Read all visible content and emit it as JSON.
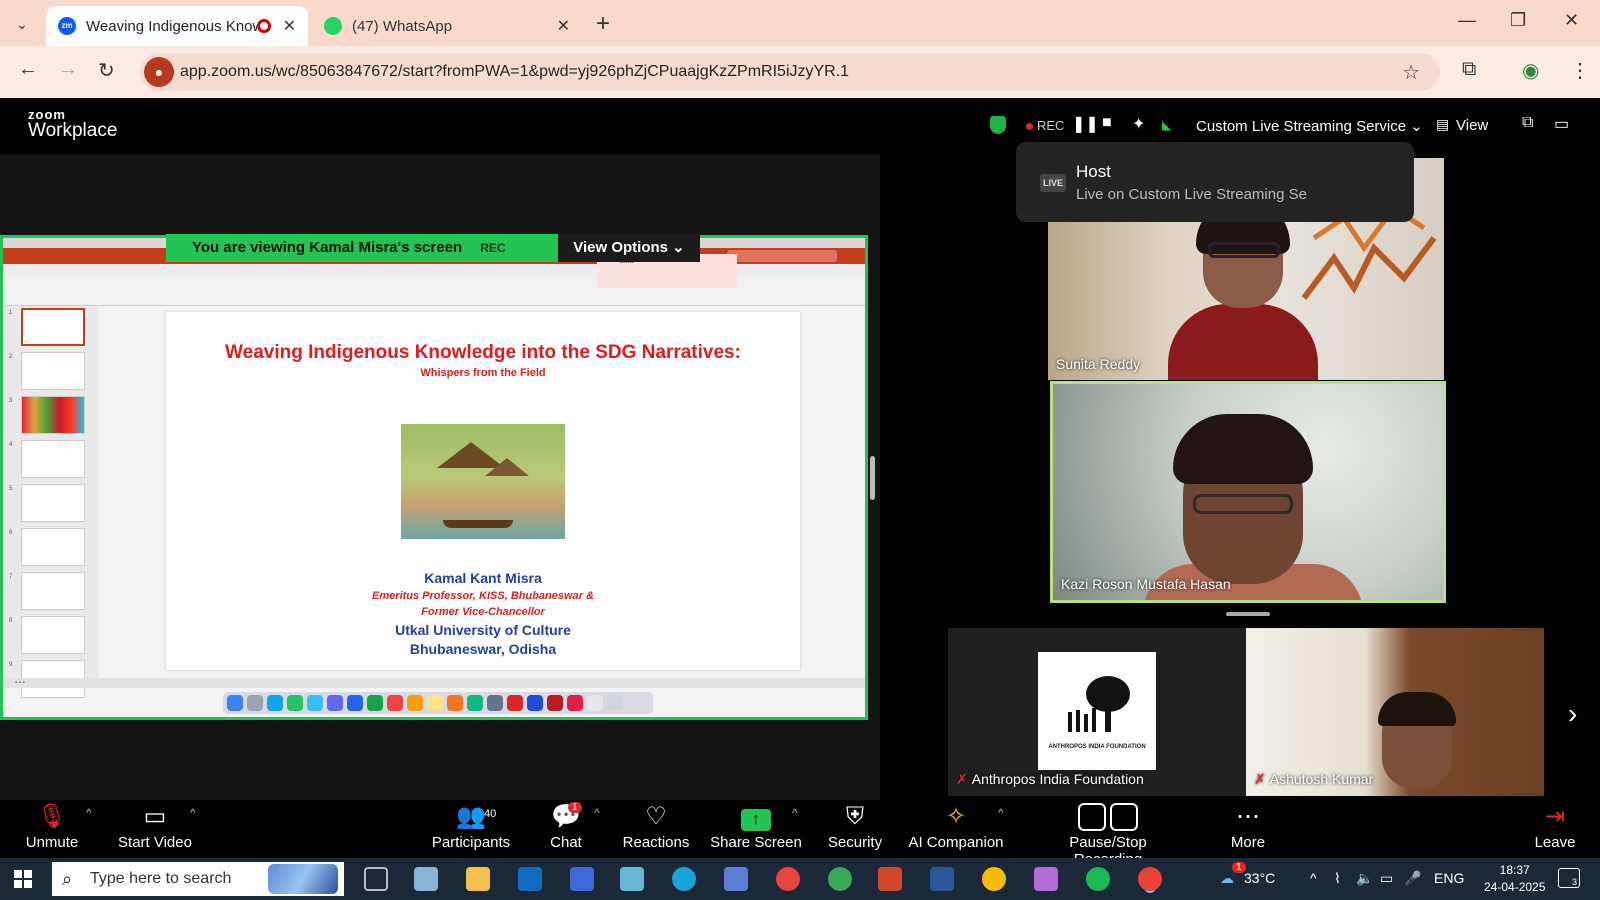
{
  "browser": {
    "tabs": [
      {
        "title": "Weaving Indigenous Knowle",
        "favicon": "zoom-icon",
        "active": true
      },
      {
        "title": "(47) WhatsApp",
        "favicon": "whatsapp-icon",
        "active": false
      }
    ],
    "url": "app.zoom.us/wc/85063847672/start?fromPWA=1&pwd=yj926phZjCPuaajgKzZPmRI5iJzyYR.1"
  },
  "zoom": {
    "logo_top": "zoom",
    "logo_bottom": "Workplace",
    "rec_label": "REC",
    "stream_service": "Custom Live Streaming Service",
    "view_label": "View",
    "host_popup": {
      "badge": "LIVE",
      "title": "Host",
      "subtitle": "Live on Custom Live Streaming Se"
    },
    "share_banner": {
      "viewing": "You are viewing  Kamal Misra's screen",
      "rec": "REC",
      "options": "View Options"
    }
  },
  "slide": {
    "title": "Weaving Indigenous Knowledge into the SDG Narratives:",
    "subtitle": "Whispers from the Field",
    "author": "Kamal Kant Misra",
    "role_line1": "Emeritus Professor, KISS, Bhubaneswar &",
    "role_line2": "Former Vice-Chancellor",
    "org_line1": "Utkal University of Culture",
    "org_line2": "Bhubaneswar, Odisha"
  },
  "participants_tiles": [
    {
      "name": "Sunita Reddy",
      "muted": false
    },
    {
      "name": "Kazi Roson Mustafa Hasan",
      "muted": false,
      "speaking": true
    },
    {
      "name": "Anthropos India Foundation",
      "muted": true
    },
    {
      "name": "Ashutosh Kumar",
      "muted": true
    }
  ],
  "toolbar": {
    "unmute": "Unmute",
    "start_video": "Start Video",
    "participants": "Participants",
    "participants_count": "40",
    "chat": "Chat",
    "chat_badge": "1",
    "reactions": "Reactions",
    "share_screen": "Share Screen",
    "security": "Security",
    "ai_companion": "AI Companion",
    "pause_stop": "Pause/Stop Recording",
    "more": "More",
    "leave": "Leave"
  },
  "taskbar": {
    "search_placeholder": "Type here to search",
    "weather_badge": "1",
    "temperature": "33°C",
    "language": "ENG",
    "time": "18:37",
    "date": "24-04-2025",
    "notification_count": "3"
  },
  "colors": {
    "share_green": "#23c552",
    "slide_red": "#e21a1a",
    "slide_blue": "#1f3ea8",
    "rec_red": "#e02828",
    "tab_bar": "#f9d9cc"
  }
}
